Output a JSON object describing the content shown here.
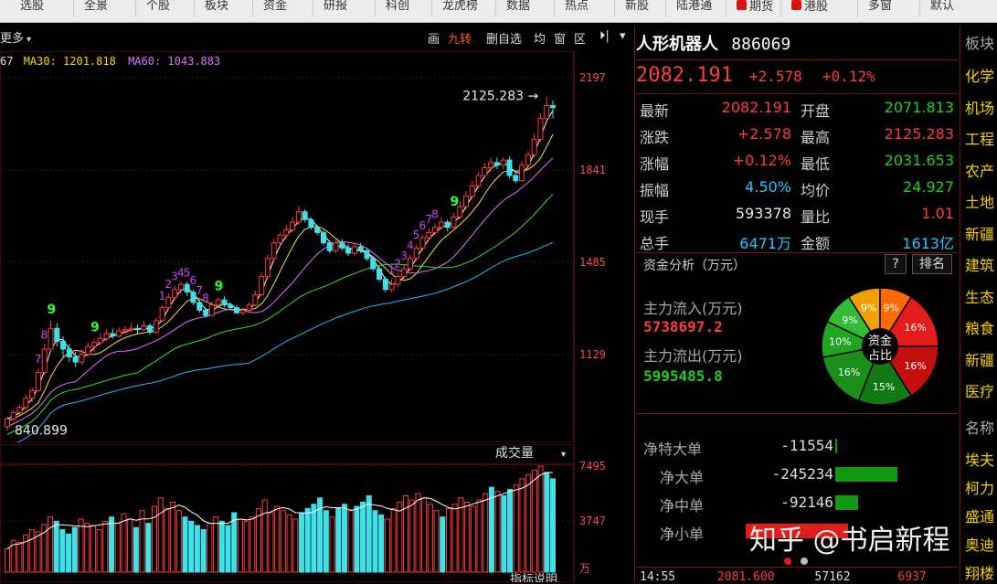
{
  "top_nav": {
    "items": [
      "选股",
      "全景",
      "个股",
      "板块",
      "资金",
      "研报",
      "科创",
      "龙虎榜",
      "数据",
      "热点",
      "新股",
      "陆港通",
      "期货",
      "港股",
      "多窗",
      "默认"
    ]
  },
  "toolbar": {
    "left_label": "更多",
    "ma_text": "67  MA30: 1201.818  MA60: 1043.883",
    "ma_prefix": "67",
    "ma30": "MA30: 1201.818",
    "ma60": "MA60: 1043.883",
    "draw": "画",
    "nine": "九转",
    "delete": "删自选",
    "equal": "均",
    "window": "窗",
    "zone": "区",
    "arrow": "⏵|",
    "dropdown": "▾"
  },
  "chart_data": {
    "type": "candlestick",
    "y_ticks": [
      "2197",
      "1841",
      "1485",
      "1129"
    ],
    "y_tick_values": [
      2197,
      1841,
      1485,
      1129
    ],
    "ylim": [
      790,
      2300
    ],
    "high_annotation": "2125.283",
    "low_annotation": "840.899",
    "high_value": 2125.283,
    "low_value": 840.899,
    "candles": [
      [
        850,
        880,
        835,
        890
      ],
      [
        880,
        905,
        870,
        915
      ],
      [
        905,
        925,
        895,
        935
      ],
      [
        925,
        960,
        915,
        975
      ],
      [
        960,
        990,
        945,
        1000
      ],
      [
        990,
        1060,
        985,
        1075
      ],
      [
        1060,
        1150,
        1050,
        1170
      ],
      [
        1150,
        1230,
        1140,
        1260
      ],
      [
        1230,
        1180,
        1160,
        1250
      ],
      [
        1180,
        1150,
        1120,
        1200
      ],
      [
        1150,
        1120,
        1100,
        1170
      ],
      [
        1120,
        1100,
        1080,
        1140
      ],
      [
        1100,
        1130,
        1090,
        1150
      ],
      [
        1130,
        1160,
        1120,
        1175
      ],
      [
        1160,
        1175,
        1140,
        1190
      ],
      [
        1175,
        1190,
        1165,
        1210
      ],
      [
        1190,
        1210,
        1180,
        1225
      ],
      [
        1210,
        1200,
        1190,
        1230
      ],
      [
        1200,
        1220,
        1195,
        1235
      ],
      [
        1220,
        1225,
        1205,
        1240
      ],
      [
        1225,
        1230,
        1215,
        1250
      ],
      [
        1230,
        1225,
        1210,
        1245
      ],
      [
        1225,
        1240,
        1220,
        1260
      ],
      [
        1240,
        1215,
        1205,
        1250
      ],
      [
        1215,
        1260,
        1210,
        1270
      ],
      [
        1260,
        1310,
        1255,
        1320
      ],
      [
        1310,
        1350,
        1300,
        1365
      ],
      [
        1350,
        1380,
        1340,
        1395
      ],
      [
        1380,
        1400,
        1365,
        1410
      ],
      [
        1400,
        1370,
        1355,
        1410
      ],
      [
        1370,
        1330,
        1320,
        1380
      ],
      [
        1330,
        1300,
        1290,
        1340
      ],
      [
        1300,
        1280,
        1270,
        1310
      ],
      [
        1280,
        1320,
        1275,
        1335
      ],
      [
        1320,
        1340,
        1310,
        1350
      ],
      [
        1340,
        1320,
        1310,
        1355
      ],
      [
        1320,
        1310,
        1300,
        1330
      ],
      [
        1310,
        1290,
        1285,
        1320
      ],
      [
        1290,
        1300,
        1280,
        1310
      ],
      [
        1300,
        1320,
        1290,
        1330
      ],
      [
        1320,
        1360,
        1315,
        1375
      ],
      [
        1360,
        1430,
        1355,
        1445
      ],
      [
        1430,
        1500,
        1425,
        1515
      ],
      [
        1500,
        1560,
        1490,
        1575
      ],
      [
        1560,
        1590,
        1550,
        1600
      ],
      [
        1590,
        1610,
        1580,
        1630
      ],
      [
        1610,
        1640,
        1600,
        1660
      ],
      [
        1640,
        1680,
        1630,
        1700
      ],
      [
        1680,
        1650,
        1640,
        1690
      ],
      [
        1650,
        1620,
        1610,
        1660
      ],
      [
        1620,
        1600,
        1590,
        1630
      ],
      [
        1600,
        1560,
        1550,
        1610
      ],
      [
        1560,
        1530,
        1520,
        1570
      ],
      [
        1530,
        1560,
        1520,
        1575
      ],
      [
        1560,
        1540,
        1530,
        1575
      ],
      [
        1540,
        1520,
        1510,
        1555
      ],
      [
        1520,
        1545,
        1510,
        1560
      ],
      [
        1545,
        1530,
        1520,
        1560
      ],
      [
        1530,
        1500,
        1490,
        1540
      ],
      [
        1500,
        1460,
        1450,
        1510
      ],
      [
        1460,
        1420,
        1410,
        1470
      ],
      [
        1420,
        1380,
        1370,
        1430
      ],
      [
        1380,
        1400,
        1370,
        1420
      ],
      [
        1400,
        1430,
        1390,
        1445
      ],
      [
        1430,
        1460,
        1420,
        1475
      ],
      [
        1460,
        1500,
        1450,
        1515
      ],
      [
        1500,
        1540,
        1490,
        1555
      ],
      [
        1540,
        1580,
        1530,
        1590
      ],
      [
        1580,
        1600,
        1570,
        1615
      ],
      [
        1600,
        1620,
        1590,
        1635
      ],
      [
        1620,
        1640,
        1610,
        1660
      ],
      [
        1640,
        1620,
        1605,
        1650
      ],
      [
        1620,
        1660,
        1615,
        1675
      ],
      [
        1660,
        1700,
        1650,
        1720
      ],
      [
        1700,
        1740,
        1690,
        1760
      ],
      [
        1740,
        1780,
        1730,
        1800
      ],
      [
        1780,
        1820,
        1770,
        1835
      ],
      [
        1820,
        1850,
        1810,
        1870
      ],
      [
        1850,
        1870,
        1840,
        1890
      ],
      [
        1870,
        1860,
        1845,
        1890
      ],
      [
        1860,
        1880,
        1845,
        1890
      ],
      [
        1880,
        1820,
        1810,
        1895
      ],
      [
        1820,
        1800,
        1790,
        1840
      ],
      [
        1800,
        1860,
        1795,
        1875
      ],
      [
        1860,
        1900,
        1850,
        1915
      ],
      [
        1900,
        1960,
        1890,
        1980
      ],
      [
        1960,
        2040,
        1950,
        2060
      ],
      [
        2040,
        2090,
        2030,
        2125
      ],
      [
        2090,
        2082,
        2040,
        2110
      ]
    ],
    "nine_labels_green": [
      "9",
      "9",
      "9",
      "9"
    ],
    "nine_labels_purple": [
      "1",
      "2",
      "3",
      "4",
      "5",
      "6",
      "7",
      "8"
    ]
  },
  "volume_chart": {
    "title": "成交量",
    "y_ticks": [
      "7495",
      "3747"
    ],
    "unit": "万",
    "bottom_label": "指标说明",
    "bars": [
      22,
      30,
      28,
      35,
      40,
      38,
      45,
      52,
      48,
      40,
      36,
      42,
      50,
      46,
      44,
      40,
      48,
      52,
      46,
      55,
      50,
      42,
      58,
      46,
      62,
      70,
      60,
      66,
      58,
      52,
      48,
      44,
      40,
      46,
      52,
      48,
      44,
      56,
      50,
      48,
      52,
      60,
      68,
      56,
      62,
      58,
      54,
      50,
      56,
      60,
      64,
      70,
      58,
      52,
      60,
      64,
      58,
      62,
      66,
      72,
      58,
      54,
      50,
      60,
      66,
      72,
      68,
      74,
      70,
      64,
      58,
      52,
      60,
      64,
      70,
      66,
      62,
      68,
      74,
      80,
      76,
      72,
      78,
      82,
      88,
      92,
      96,
      100,
      94,
      88
    ]
  },
  "stock": {
    "name": "人形机器人",
    "code": "886069",
    "price": "2082.191",
    "change": "+2.578",
    "pct": "+0.12%"
  },
  "quote": {
    "rows": [
      {
        "l1": "最新",
        "v1": "2082.191",
        "c1": "red",
        "l2": "开盘",
        "v2": "2071.813",
        "c2": "green"
      },
      {
        "l1": "涨跌",
        "v1": "+2.578",
        "c1": "red",
        "l2": "最高",
        "v2": "2125.283",
        "c2": "red"
      },
      {
        "l1": "涨幅",
        "v1": "+0.12%",
        "c1": "red",
        "l2": "最低",
        "v2": "2031.653",
        "c2": "green"
      },
      {
        "l1": "振幅",
        "v1": "4.50%",
        "c1": "cyan",
        "l2": "均价",
        "v2": "24.927",
        "c2": "green"
      },
      {
        "l1": "现手",
        "v1": "593378",
        "c1": "white",
        "l2": "量比",
        "v2": "1.01",
        "c2": "red"
      },
      {
        "l1": "总手",
        "v1": "6471万",
        "c1": "cyan",
        "l2": "金额",
        "v2": "1613亿",
        "c2": "cyan"
      }
    ]
  },
  "fund": {
    "title": "资金分析（万元）",
    "help": "?",
    "rank": "排名",
    "inflow_label": "主力流入(万元)",
    "inflow_value": "5738697.2",
    "outflow_label": "主力流出(万元)",
    "outflow_value": "5995485.8",
    "pie_center_1": "资金",
    "pie_center_2": "占比",
    "pie": [
      {
        "label": "9%",
        "value": 9,
        "color": "#f0a000"
      },
      {
        "label": "9%",
        "value": 9,
        "color": "#ff6a00"
      },
      {
        "label": "16%",
        "value": 16,
        "color": "#e31b1b"
      },
      {
        "label": "16%",
        "value": 16,
        "color": "#c40f0f"
      },
      {
        "label": "15%",
        "value": 15,
        "color": "#137a13"
      },
      {
        "label": "16%",
        "value": 16,
        "color": "#1a8f1a"
      },
      {
        "label": "10%",
        "value": 10,
        "color": "#22a322"
      },
      {
        "label": "9%",
        "value": 9,
        "color": "#34bb34"
      }
    ]
  },
  "net": {
    "rows": [
      {
        "label": "净特大单",
        "value": "-11554",
        "bar": 2
      },
      {
        "label": "净大单",
        "value": "-245234",
        "bar": 68
      },
      {
        "label": "净中单",
        "value": "-92146",
        "bar": 25
      },
      {
        "label": "净小单",
        "value": "",
        "bar": 0
      }
    ]
  },
  "bottom_row": {
    "time": "14:55",
    "price": "2081.600",
    "vol": "57162",
    "last": "6937"
  },
  "watermark": "知乎 @书启新程",
  "sectors": {
    "header": "板块",
    "items": [
      "化学",
      "机场",
      "工程",
      "农产",
      "土地",
      "新疆",
      "建筑",
      "生态",
      "粮食",
      "新疆",
      "医疗"
    ],
    "header2": "名称",
    "items2": [
      "埃夫",
      "柯力",
      "盛通",
      "奥迪",
      "翔楼"
    ]
  }
}
